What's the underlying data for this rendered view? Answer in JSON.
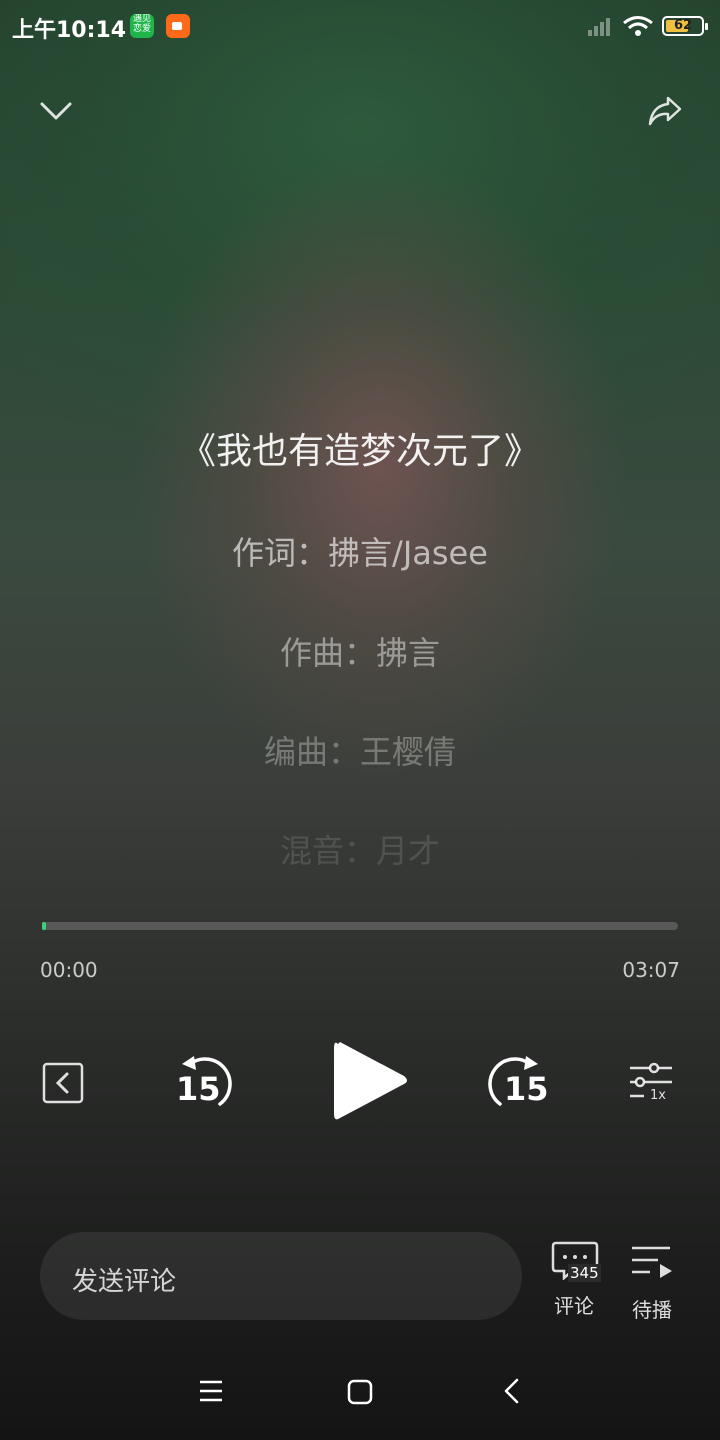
{
  "status_bar": {
    "time": "上午10:14",
    "app_icon_text": "遇见恋爱",
    "battery": "62"
  },
  "lyrics": {
    "title": "《我也有造梦次元了》",
    "lines": [
      "作词：拂言/Jasee",
      "作曲：拂言",
      "编曲：王樱倩",
      "混音：月才"
    ]
  },
  "playback": {
    "progress": 0.004,
    "current_time": "00:00",
    "total_time": "03:07",
    "rewind_seconds": "15",
    "forward_seconds": "15",
    "speed": "1x"
  },
  "bottom": {
    "comment_placeholder": "发送评论",
    "comment_count": "345",
    "comment_label": "评论",
    "queue_label": "待播"
  },
  "colors": {
    "accent": "#3fcf7a",
    "battery": "#f0c040"
  }
}
